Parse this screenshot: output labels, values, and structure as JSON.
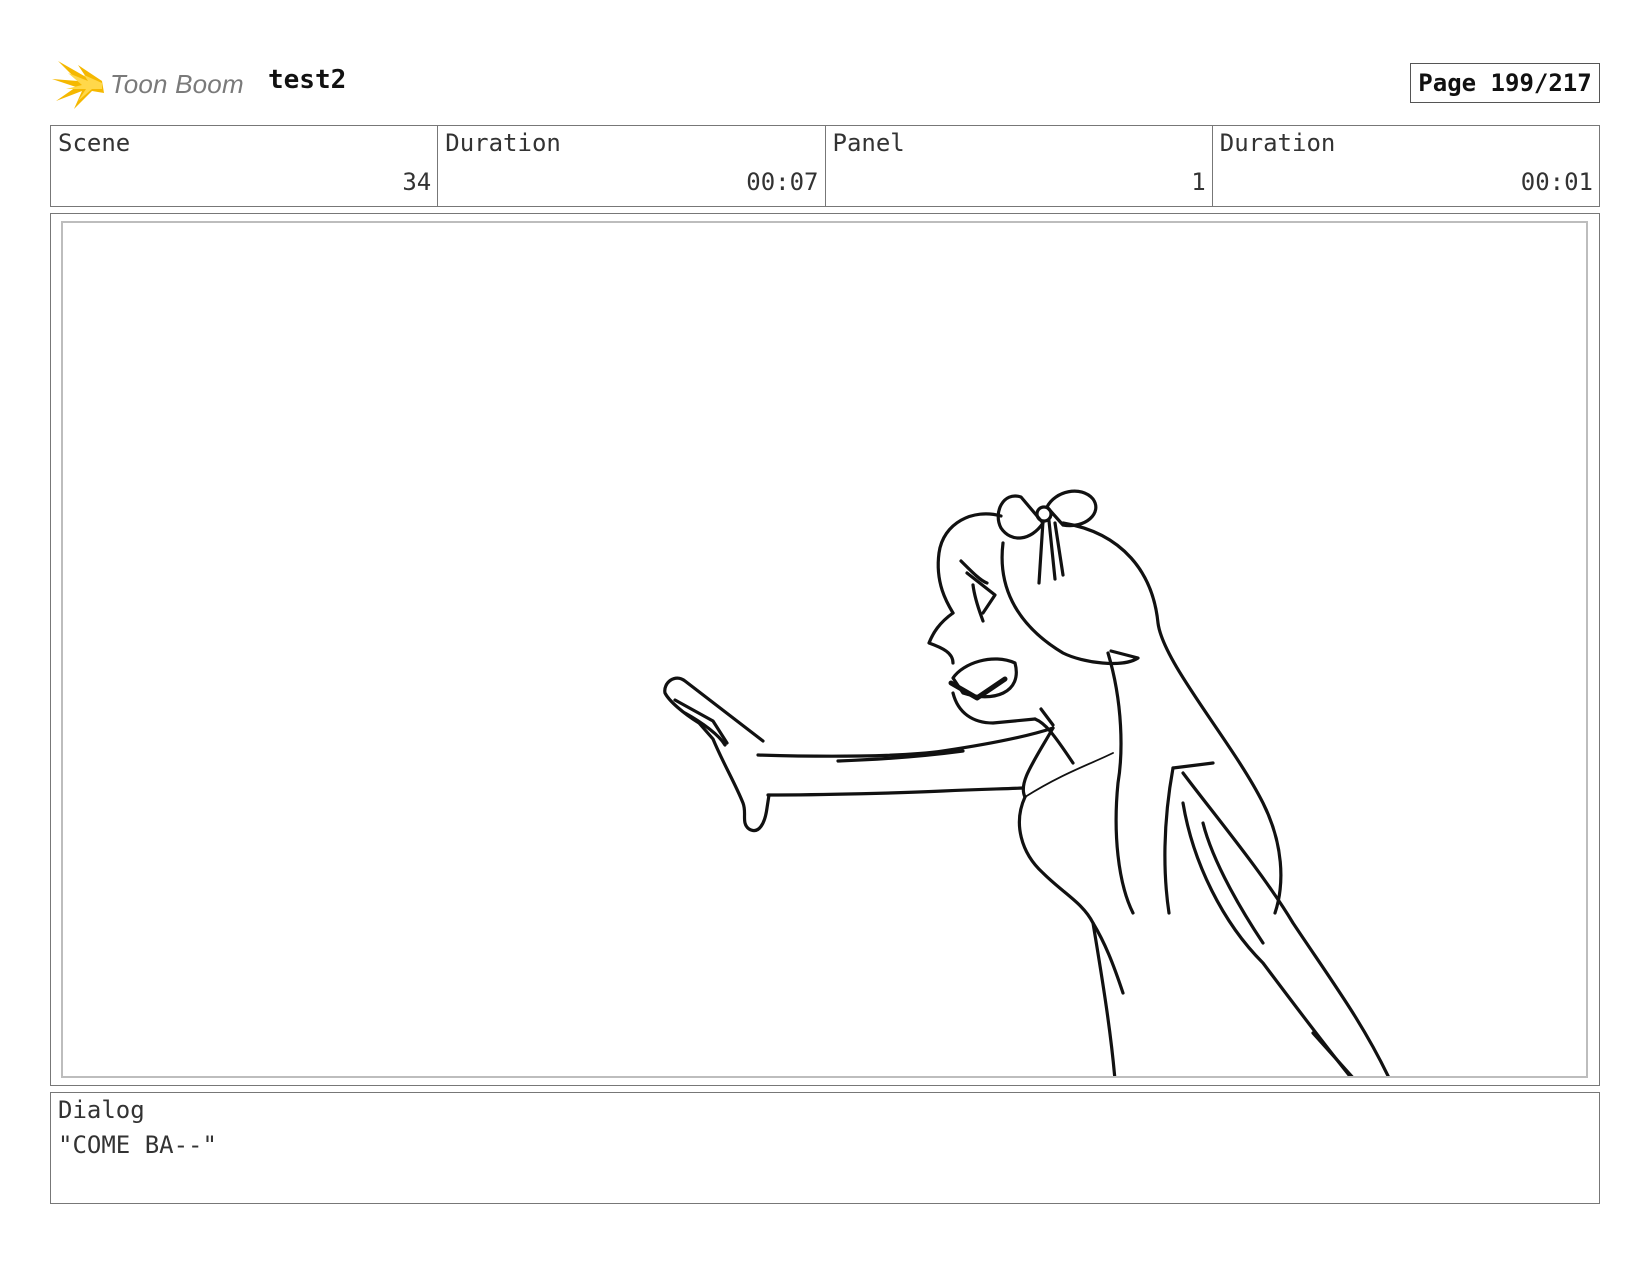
{
  "header": {
    "brand": "Toon Boom",
    "brand_color": "#f5b800",
    "project_title": "test2",
    "page_label": "Page 199/217"
  },
  "info": [
    {
      "label": "Scene",
      "value": "34"
    },
    {
      "label": "Duration",
      "value": "00:07"
    },
    {
      "label": "Panel",
      "value": "1"
    },
    {
      "label": "Duration",
      "value": "00:01"
    }
  ],
  "panel": {
    "icon": "sketch-character-reaching-icon"
  },
  "dialog": {
    "label": "Dialog",
    "text": "\"COME BA--\""
  }
}
